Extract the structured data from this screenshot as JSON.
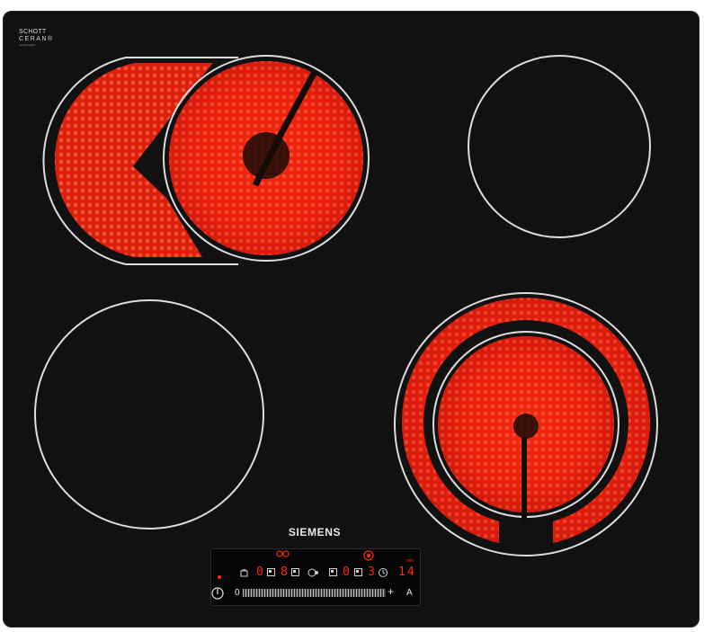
{
  "cooktop": {
    "brand": "SIEMENS",
    "glass_logo": {
      "line1": "SCHOTT",
      "line2": "CERAN®",
      "line3": "ceramic glass"
    },
    "zones": [
      {
        "name": "front-left",
        "state": "off"
      },
      {
        "name": "rear-left-dual",
        "state": "on",
        "glow": "#ff2a14"
      },
      {
        "name": "rear-right",
        "state": "off"
      },
      {
        "name": "front-right-dual",
        "state": "on",
        "glow": "#ff2a14"
      }
    ]
  },
  "control_panel": {
    "power_label": "⏻",
    "slider_min": "0",
    "slider_plus": "+",
    "auto_label": "A",
    "timer_minutes": "14",
    "min_label": "min",
    "display_1": "0",
    "display_2": "8",
    "display_3": "0",
    "display_4": "3",
    "power_indicator_color": "#ff2a10"
  }
}
